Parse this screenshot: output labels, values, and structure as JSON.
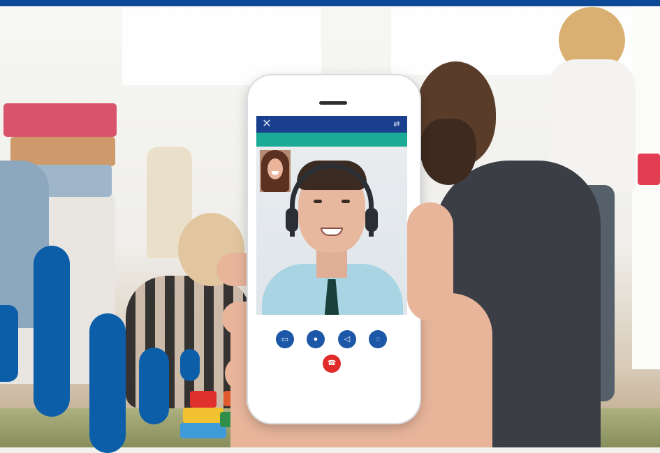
{
  "header": {
    "bar_color": "#0c4a97"
  },
  "decor": {
    "bar_color": "#0c5ea8"
  },
  "call_app": {
    "app_bar_color": "#1a3f8f",
    "accent_bar_color": "#1aaa96",
    "close_icon": "close-icon",
    "switch_camera_icon": "switch-camera-icon",
    "controls": [
      {
        "name": "video-camera-icon",
        "glyph": "▭"
      },
      {
        "name": "microphone-icon",
        "glyph": "●"
      },
      {
        "name": "speaker-icon",
        "glyph": "◁"
      },
      {
        "name": "chat-icon",
        "glyph": "◌"
      }
    ],
    "control_color": "#1d58a8",
    "end_call": {
      "icon": "end-call-icon",
      "color": "#e12a2a"
    }
  }
}
